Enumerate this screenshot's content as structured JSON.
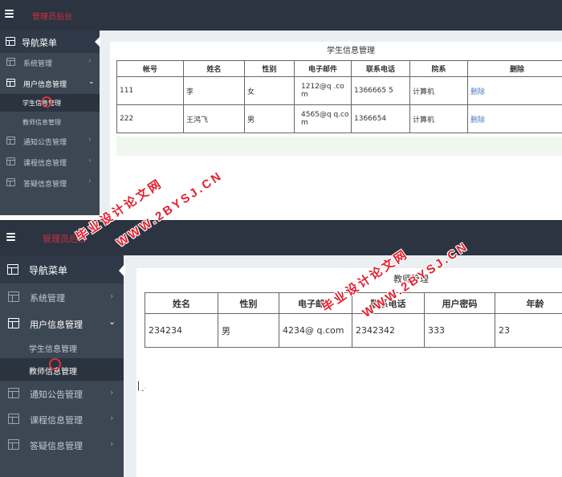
{
  "screenshot_top": {
    "brand": "管理员后台",
    "nav_header": "导航菜单",
    "menu": [
      {
        "label": "系统管理"
      },
      {
        "label": "用户信息管理"
      },
      {
        "label": "通知公告管理"
      },
      {
        "label": "课程信息管理"
      },
      {
        "label": "答疑信息管理"
      }
    ],
    "submenu": [
      {
        "label": "学生信息管理"
      },
      {
        "label": "教师信息管理"
      }
    ],
    "page_title": "学生信息管理",
    "table": {
      "headers": [
        "帐号",
        "姓名",
        "性别",
        "电子邮件",
        "联系电话",
        "院系",
        "删除"
      ],
      "rows": [
        {
          "cells": [
            "111",
            "李",
            "女",
            "1212@q .com",
            "1366665 5",
            "计算机",
            "删除"
          ]
        },
        {
          "cells": [
            "222",
            "王鸿飞",
            "男",
            "4565@q q.com",
            "1366654",
            "计算机",
            "删除"
          ]
        }
      ]
    }
  },
  "screenshot_bottom": {
    "brand": "管理员后台",
    "nav_header": "导航菜单",
    "menu": [
      {
        "label": "系统管理"
      },
      {
        "label": "用户信息管理"
      },
      {
        "label": "通知公告管理"
      },
      {
        "label": "课程信息管理"
      },
      {
        "label": "答疑信息管理"
      }
    ],
    "submenu": [
      {
        "label": "学生信息管理"
      },
      {
        "label": "教师信息管理"
      }
    ],
    "page_title": "教师管理",
    "table": {
      "headers": [
        "姓名",
        "性别",
        "电子邮件",
        "联系电话",
        "用户密码",
        "年龄"
      ],
      "rows": [
        {
          "cells": [
            "234234",
            "男",
            "4234@ q.com",
            "2342342",
            "333",
            "23"
          ]
        }
      ]
    }
  },
  "watermark": {
    "line1": "毕业设计论文网",
    "line2": "WWW.2BYSJ.CN",
    "color": "#e2212f"
  },
  "colors": {
    "topbar": "#2b3440",
    "sidebar": "#3c4754",
    "brand": "#d32e3f",
    "link": "#4a7cc7",
    "highlight_band": "#eff7ee"
  },
  "icons": {
    "menu_toggle": "hamburger-icon",
    "nav_item": "window-icon",
    "chevron_closed": "chevron-right-icon",
    "chevron_open": "chevron-down-icon"
  }
}
